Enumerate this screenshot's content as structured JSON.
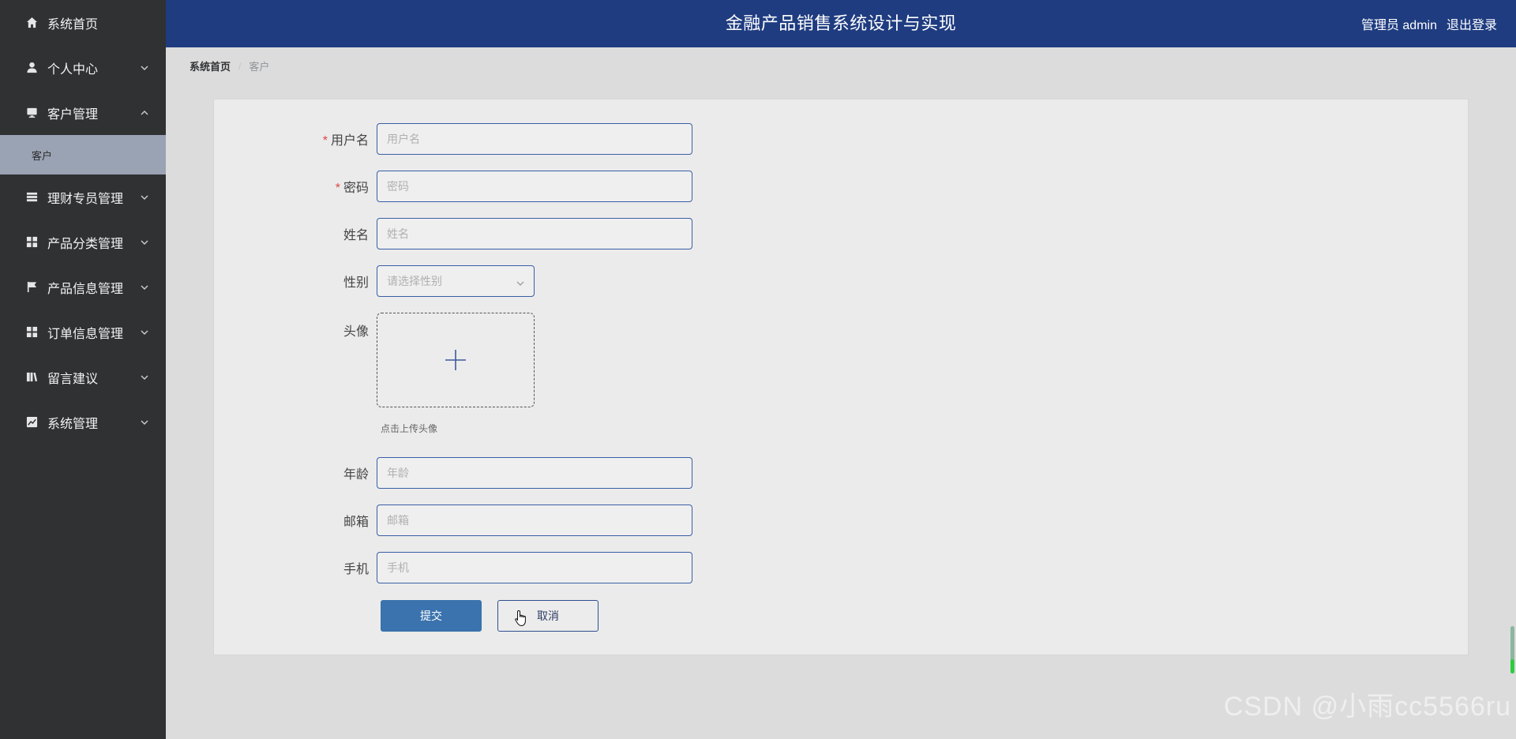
{
  "header": {
    "title": "金融产品销售系统设计与实现",
    "user_label": "管理员 admin",
    "logout_label": "退出登录",
    "bg_color": "#1f3c80"
  },
  "sidebar": {
    "items": [
      {
        "label": "系统首页",
        "icon": "home-icon"
      },
      {
        "label": "个人中心",
        "icon": "user-icon"
      },
      {
        "label": "客户管理",
        "icon": "monitor-icon",
        "expanded": true,
        "children": [
          {
            "label": "客户"
          }
        ]
      },
      {
        "label": "理财专员管理",
        "icon": "list-icon"
      },
      {
        "label": "产品分类管理",
        "icon": "grid-icon"
      },
      {
        "label": "产品信息管理",
        "icon": "flag-icon"
      },
      {
        "label": "订单信息管理",
        "icon": "grid-icon"
      },
      {
        "label": "留言建议",
        "icon": "book-icon"
      },
      {
        "label": "系统管理",
        "icon": "chart-icon"
      }
    ]
  },
  "breadcrumb": {
    "home": "系统首页",
    "separator": "/",
    "current": "客户"
  },
  "form": {
    "username": {
      "label": "用户名",
      "placeholder": "用户名",
      "value": ""
    },
    "password": {
      "label": "密码",
      "placeholder": "密码",
      "value": ""
    },
    "name": {
      "label": "姓名",
      "placeholder": "姓名",
      "value": ""
    },
    "gender": {
      "label": "性别",
      "placeholder": "请选择性别"
    },
    "avatar": {
      "label": "头像",
      "tip": "点击上传头像"
    },
    "age": {
      "label": "年龄",
      "placeholder": "年龄",
      "value": ""
    },
    "email": {
      "label": "邮箱",
      "placeholder": "邮箱",
      "value": ""
    },
    "phone": {
      "label": "手机",
      "placeholder": "手机",
      "value": ""
    },
    "required_mark": "*",
    "submit_label": "提交",
    "cancel_label": "取消"
  },
  "watermark": "CSDN @小雨cc5566ru"
}
